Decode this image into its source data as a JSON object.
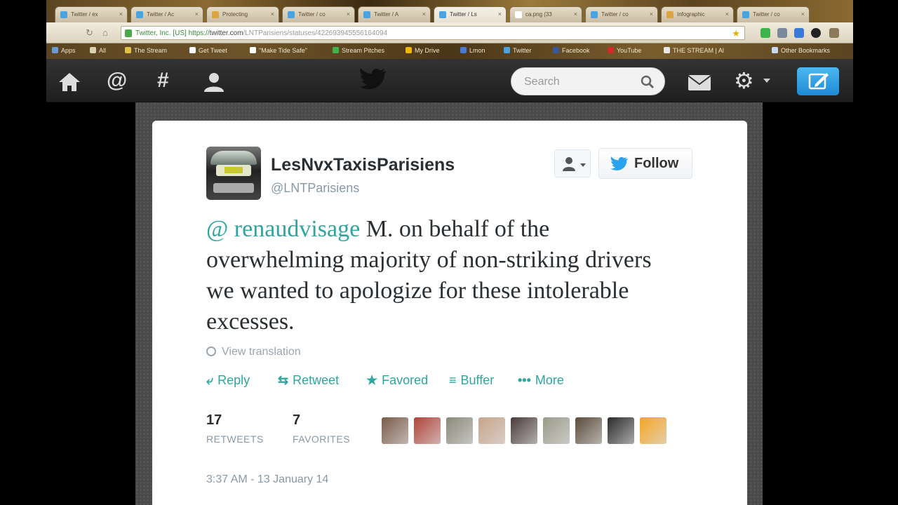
{
  "browser": {
    "tabs": [
      {
        "label": "Twitter / ex",
        "active": false,
        "color": "#4aa3df"
      },
      {
        "label": "Twitter / Ac",
        "active": false,
        "color": "#4aa3df"
      },
      {
        "label": "Protecting",
        "active": false,
        "color": "#d9a441"
      },
      {
        "label": "Twitter / co",
        "active": false,
        "color": "#4aa3df"
      },
      {
        "label": "Twitter / A",
        "active": false,
        "color": "#4aa3df"
      },
      {
        "label": "Twitter / Ls",
        "active": true,
        "color": "#4aa3df"
      },
      {
        "label": "ca.png (33",
        "active": false,
        "color": "#ffffff"
      },
      {
        "label": "Twitter / co",
        "active": false,
        "color": "#4aa3df"
      },
      {
        "label": "Infographic",
        "active": false,
        "color": "#d9a441"
      },
      {
        "label": "Twitter / co",
        "active": false,
        "color": "#4aa3df"
      }
    ],
    "address": {
      "secure_label": "Twitter, Inc. [US]",
      "scheme": "https://",
      "host": "twitter.com",
      "path": "/LNTParisiens/statuses/422693945556164094"
    },
    "bookmarks": [
      {
        "label": "Apps",
        "color": "#6a9ad6"
      },
      {
        "label": "All",
        "color": "#d9d0b0"
      },
      {
        "label": "The Stream",
        "color": "#e0c040"
      },
      {
        "label": "Get Tweet",
        "color": "#ffffff"
      },
      {
        "label": "\"Make Tide Safe\"",
        "color": "#ffffff"
      },
      {
        "label": "Stream Pitches",
        "color": "#3cb44b"
      },
      {
        "label": "My Drive",
        "color": "#f0b800"
      },
      {
        "label": "Lmon",
        "color": "#4a7ad6"
      },
      {
        "label": "Twitter",
        "color": "#4aa3df"
      },
      {
        "label": "Facebook",
        "color": "#3b5998"
      },
      {
        "label": "YouTube",
        "color": "#d62a2a"
      },
      {
        "label": "THE STREAM | Al",
        "color": "#e8e8e8"
      },
      {
        "label": "Other Bookmarks",
        "color": "#c8d8f0"
      }
    ]
  },
  "nav": {
    "search_placeholder": "Search"
  },
  "tweet": {
    "display_name": "LesNvxTaxisParisiens",
    "handle": "@LNTParisiens",
    "follow_label": "Follow",
    "mention": "@ renaudvisage",
    "text": " M. on behalf of the overwhelming majority of non-striking drivers we wanted to apologize for these intolerable excesses.",
    "translate_label": "View translation",
    "actions": {
      "reply": "Reply",
      "retweet": "Retweet",
      "favorite": "Favored",
      "buffer": "Buffer",
      "more": "More"
    },
    "retweets_count": "17",
    "retweets_label": "RETWEETS",
    "favorites_count": "7",
    "favorites_label": "FAVORITES",
    "faces": [
      "#7a5a48",
      "#b0443a",
      "#8a8a7a",
      "#c9a48a",
      "#4a3a3a",
      "#9a9a8a",
      "#5a4a3a",
      "#2a2a2a",
      "#f5a623"
    ],
    "timestamp": "3:37 AM - 13 January 14"
  }
}
